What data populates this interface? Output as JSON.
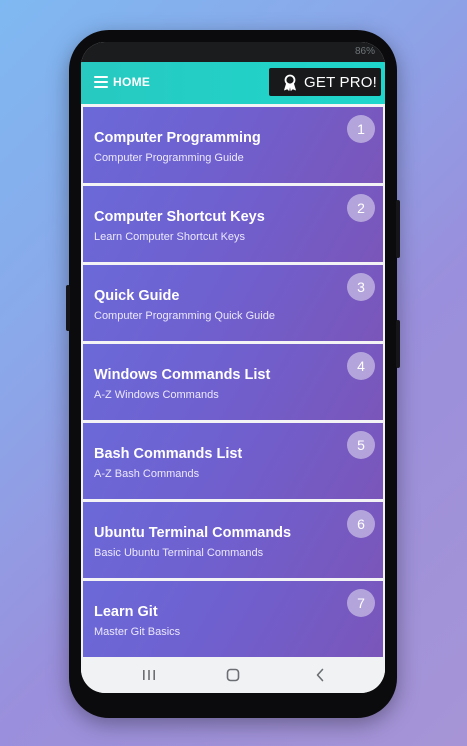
{
  "status_bar": {
    "battery": "86%"
  },
  "app_bar": {
    "home_label": "HOME",
    "pro_label": "GET PRO!"
  },
  "items": [
    {
      "number": "1",
      "title": "Computer Programming",
      "subtitle": "Computer Programming Guide"
    },
    {
      "number": "2",
      "title": "Computer Shortcut Keys",
      "subtitle": "Learn Computer Shortcut Keys"
    },
    {
      "number": "3",
      "title": "Quick Guide",
      "subtitle": "Computer Programming Quick Guide"
    },
    {
      "number": "4",
      "title": "Windows Commands List",
      "subtitle": "A-Z Windows Commands"
    },
    {
      "number": "5",
      "title": "Bash Commands List",
      "subtitle": "A-Z Bash Commands"
    },
    {
      "number": "6",
      "title": "Ubuntu Terminal Commands",
      "subtitle": "Basic Ubuntu Terminal Commands"
    },
    {
      "number": "7",
      "title": "Learn Git",
      "subtitle": "Master Git Basics"
    }
  ],
  "icons": {
    "menu": "hamburger-menu-icon",
    "pro": "award-ribbon-icon",
    "recents": "recent-apps-icon",
    "home": "home-icon",
    "back": "back-chevron-icon"
  },
  "colors": {
    "app_bar": "#22cfc5",
    "card_start": "#6b69d8",
    "card_end": "#7a56b9",
    "pro_button": "#17191b"
  }
}
